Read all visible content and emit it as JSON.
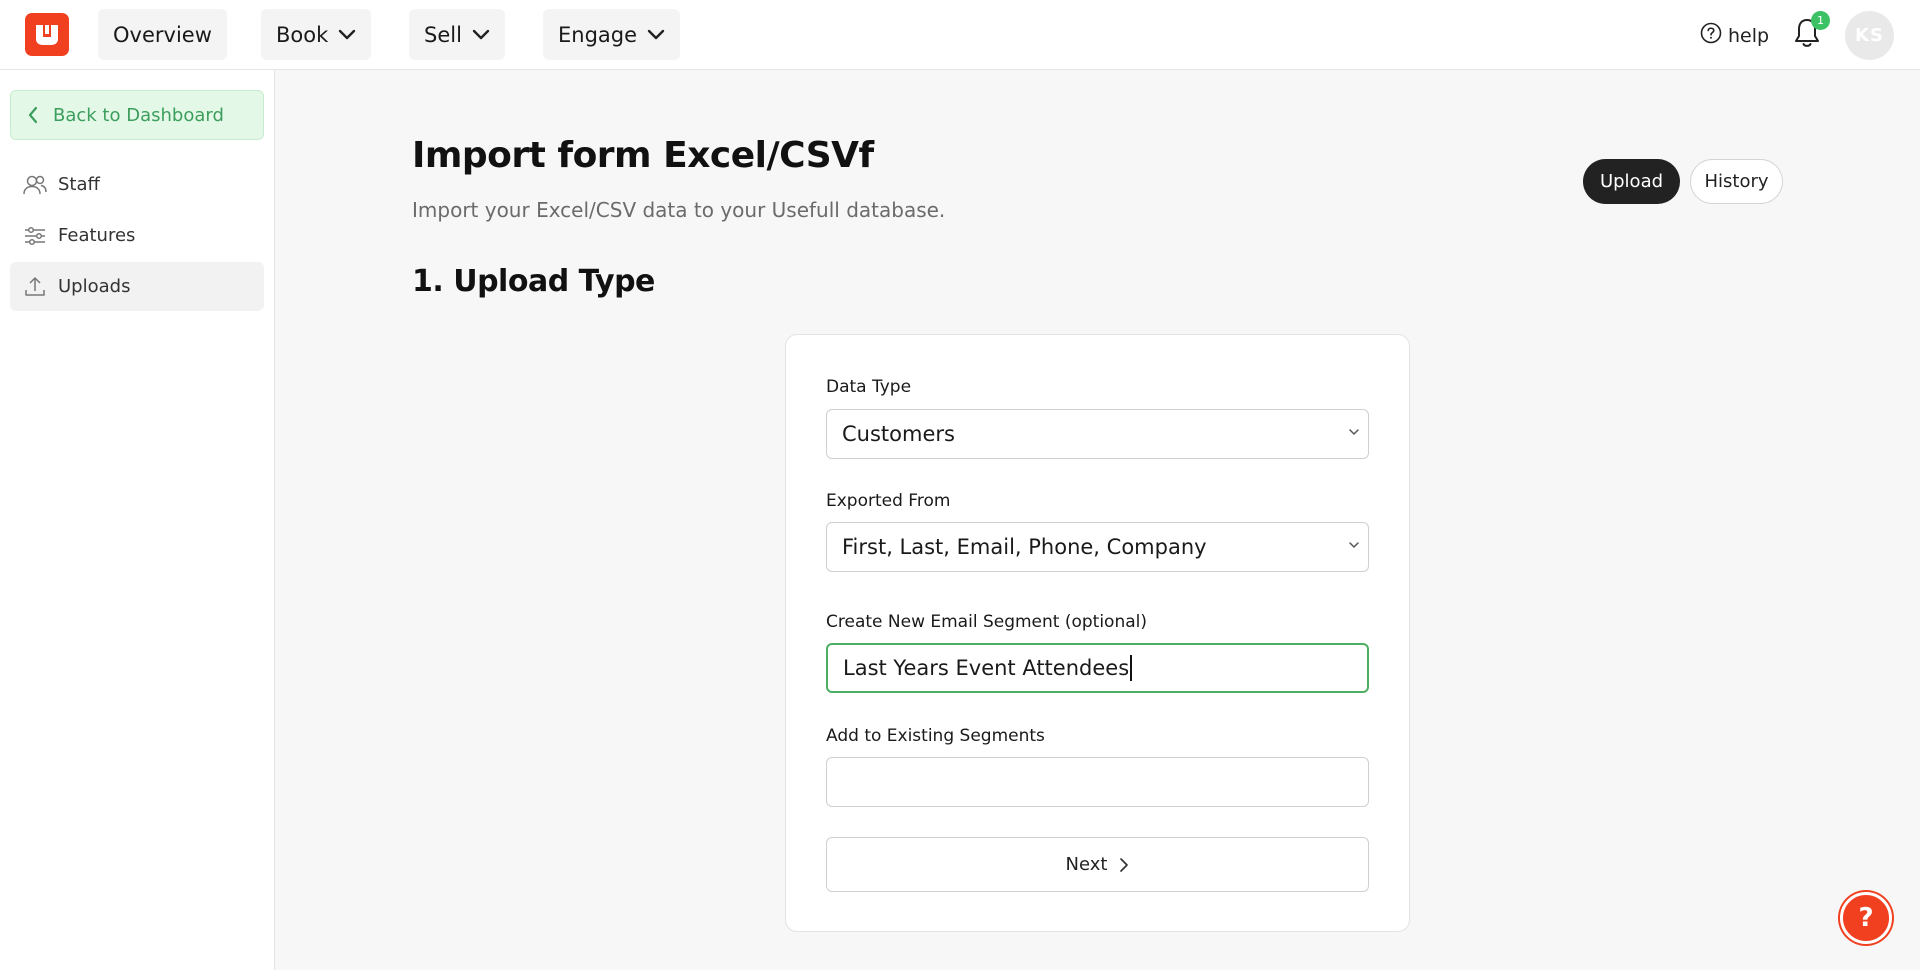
{
  "nav": {
    "overview": "Overview",
    "book": "Book",
    "sell": "Sell",
    "engage": "Engage",
    "help": "help",
    "notification_count": "1",
    "avatar_initials": "KS"
  },
  "sidebar": {
    "back": "Back to Dashboard",
    "items": [
      {
        "label": "Staff",
        "icon": "staff-icon"
      },
      {
        "label": "Features",
        "icon": "sliders-icon"
      },
      {
        "label": "Uploads",
        "icon": "upload-icon",
        "active": true
      }
    ]
  },
  "main": {
    "title": "Import form Excel/CSVf",
    "subtitle": "Import your Excel/CSV data to your Usefull database.",
    "section": "1. Upload Type",
    "tabs": {
      "upload": "Upload",
      "history": "History"
    }
  },
  "form": {
    "data_type": {
      "label": "Data Type",
      "value": "Customers"
    },
    "exported_from": {
      "label": "Exported From",
      "value": "First, Last, Email, Phone, Company"
    },
    "new_segment": {
      "label": "Create New Email Segment (optional)",
      "value": "Last Years Event Attendees"
    },
    "existing_segments": {
      "label": "Add to Existing Segments",
      "value": ""
    },
    "next": "Next"
  },
  "fab": {
    "label": "?"
  },
  "colors": {
    "brand": "#f0401f",
    "accent_green": "#3c9e5d",
    "dark": "#222222"
  }
}
